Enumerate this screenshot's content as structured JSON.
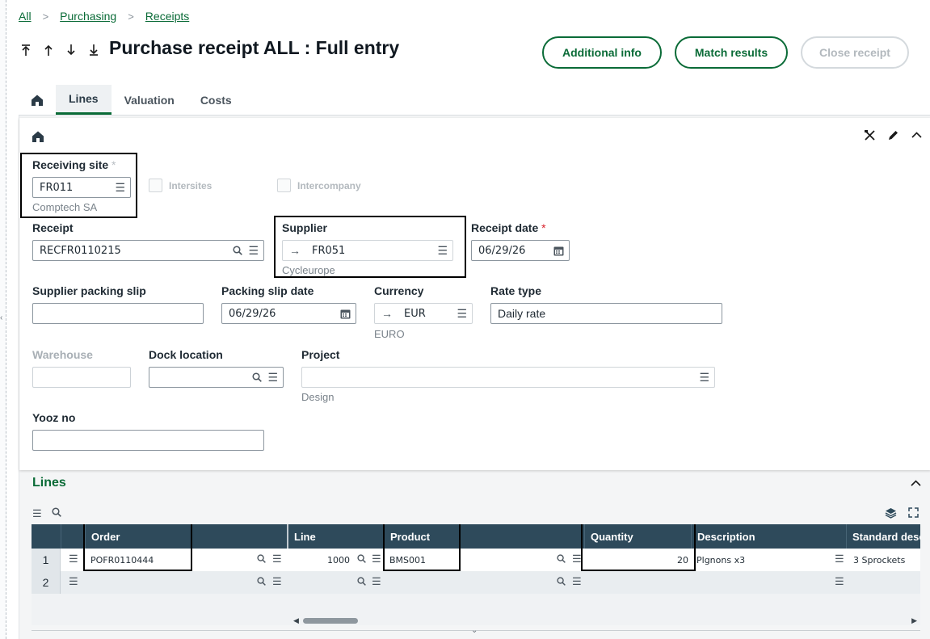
{
  "breadcrumb": [
    "All",
    "Purchasing",
    "Receipts"
  ],
  "title": "Purchase receipt ALL : Full entry",
  "actions": {
    "additional_info": "Additional info",
    "match_results": "Match results",
    "close_receipt": "Close receipt"
  },
  "tabs": [
    "Lines",
    "Valuation",
    "Costs"
  ],
  "form": {
    "receiving_site": {
      "label": "Receiving site",
      "required_mark": "*",
      "value": "FR011",
      "desc": "Comptech SA"
    },
    "intersites": "Intersites",
    "intercompany": "Intercompany",
    "receipt": {
      "label": "Receipt",
      "value": "RECFR0110215"
    },
    "supplier": {
      "label": "Supplier",
      "value": "FR051",
      "desc": "Cycleurope"
    },
    "receipt_date": {
      "label": "Receipt date",
      "required_mark": "*",
      "value": "06/29/26"
    },
    "supplier_packing_slip": {
      "label": "Supplier packing slip",
      "value": ""
    },
    "packing_slip_date": {
      "label": "Packing slip date",
      "value": "06/29/26"
    },
    "currency": {
      "label": "Currency",
      "value": "EUR",
      "desc": "EURO"
    },
    "rate_type": {
      "label": "Rate type",
      "value": "Daily rate"
    },
    "warehouse": {
      "label": "Warehouse",
      "value": ""
    },
    "dock_location": {
      "label": "Dock location",
      "value": ""
    },
    "project": {
      "label": "Project",
      "value": "",
      "desc": "Design"
    },
    "yooz_no": {
      "label": "Yooz no",
      "value": ""
    }
  },
  "lines": {
    "title": "Lines",
    "columns": [
      "Order",
      "Line",
      "Product",
      "Quantity",
      "Description",
      "Standard desc"
    ],
    "rows": [
      {
        "num": "1",
        "order": "POFR0110444",
        "line": "1000",
        "product": "BMS001",
        "quantity": "20",
        "description": "Plgnons x3",
        "standard_desc": "3 Sprockets"
      },
      {
        "num": "2",
        "order": "",
        "line": "",
        "product": "",
        "quantity": "",
        "description": "",
        "standard_desc": ""
      }
    ]
  },
  "colors": {
    "accent": "#0a6b37",
    "grid_header": "#2e4a5b",
    "required": "#d8202a"
  }
}
